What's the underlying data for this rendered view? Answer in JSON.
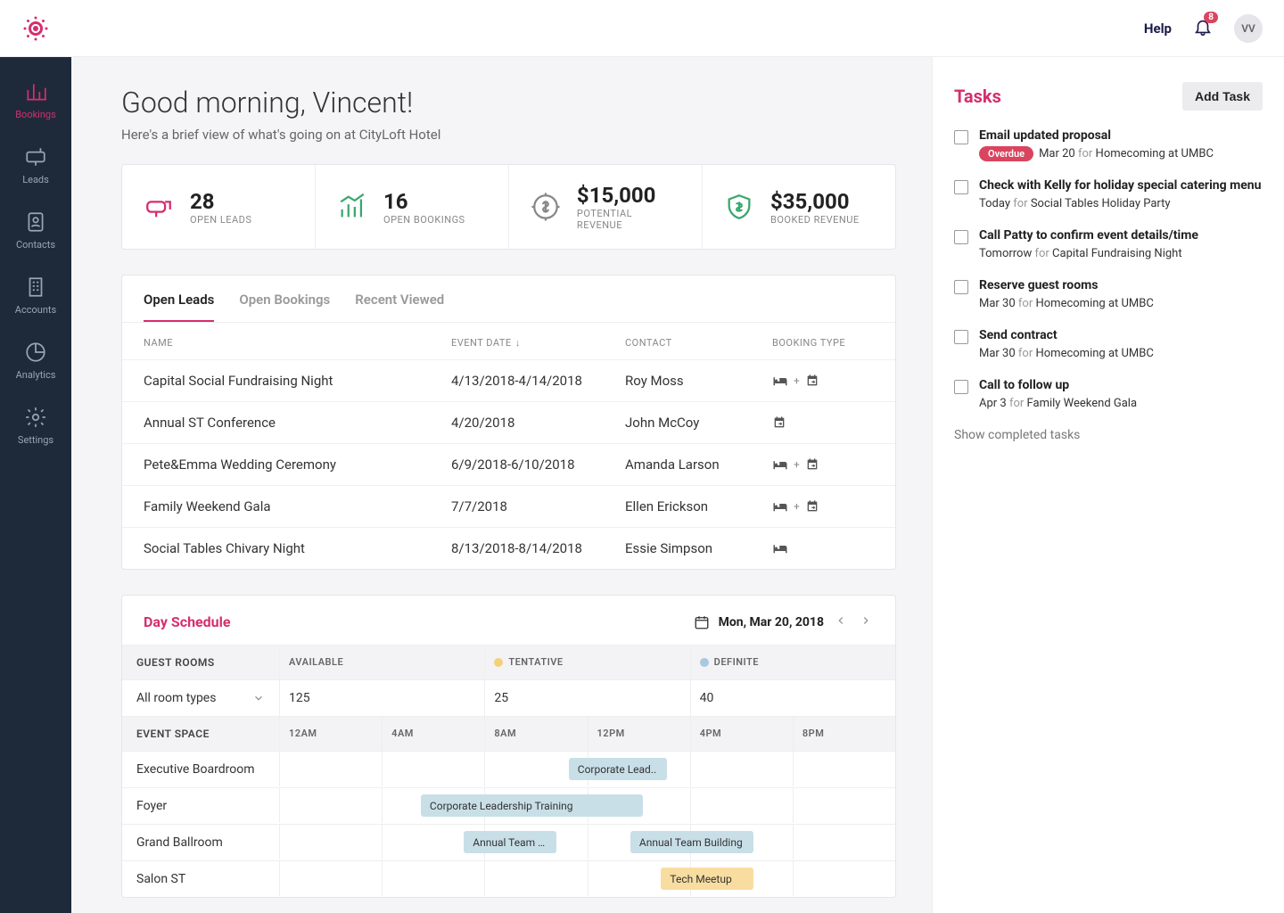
{
  "topbar": {
    "help": "Help",
    "notif_count": "8",
    "avatar": "VV"
  },
  "sidenav": [
    {
      "id": "bookings",
      "label": "Bookings"
    },
    {
      "id": "leads",
      "label": "Leads"
    },
    {
      "id": "contacts",
      "label": "Contacts"
    },
    {
      "id": "accounts",
      "label": "Accounts"
    },
    {
      "id": "analytics",
      "label": "Analytics"
    },
    {
      "id": "settings",
      "label": "Settings"
    }
  ],
  "header": {
    "greeting": "Good morning, Vincent!",
    "subtitle": "Here's a brief view of what's going on at CityLoft Hotel"
  },
  "stats": [
    {
      "value": "28",
      "label": "OPEN LEADS"
    },
    {
      "value": "16",
      "label": "OPEN BOOKINGS"
    },
    {
      "value": "$15,000",
      "label": "POTENTIAL REVENUE"
    },
    {
      "value": "$35,000",
      "label": "BOOKED REVENUE"
    }
  ],
  "tabs": {
    "open_leads": "Open Leads",
    "open_bookings": "Open Bookings",
    "recent_viewed": "Recent Viewed"
  },
  "table": {
    "cols": {
      "name": "NAME",
      "date": "EVENT DATE",
      "contact": "CONTACT",
      "type": "BOOKING TYPE"
    },
    "rows": [
      {
        "name": "Capital Social Fundraising Night",
        "date": "4/13/2018-4/14/2018",
        "contact": "Roy Moss",
        "types": [
          "bed",
          "cal"
        ]
      },
      {
        "name": "Annual ST Conference",
        "date": "4/20/2018",
        "contact": "John McCoy",
        "types": [
          "cal"
        ]
      },
      {
        "name": "Pete&Emma Wedding Ceremony",
        "date": "6/9/2018-6/10/2018",
        "contact": "Amanda Larson",
        "types": [
          "bed",
          "cal"
        ]
      },
      {
        "name": "Family Weekend Gala",
        "date": "7/7/2018",
        "contact": "Ellen Erickson",
        "types": [
          "bed",
          "cal"
        ]
      },
      {
        "name": "Social Tables Chivary Night",
        "date": "8/13/2018-8/14/2018",
        "contact": "Essie Simpson",
        "types": [
          "bed"
        ]
      }
    ]
  },
  "schedule": {
    "title": "Day Schedule",
    "date": "Mon, Mar 20, 2018",
    "guest_rooms_label": "GUEST ROOMS",
    "available_label": "AVAILABLE",
    "tentative_label": "TENTATIVE",
    "definite_label": "DEFINITE",
    "room_type_label": "All room types",
    "available_val": "125",
    "tentative_val": "25",
    "definite_val": "40",
    "event_space_label": "EVENT SPACE",
    "hours": [
      "12AM",
      "4AM",
      "8AM",
      "12PM",
      "4PM",
      "8PM"
    ],
    "rooms": [
      {
        "name": "Executive Boardroom",
        "events": [
          {
            "label": "Corporate Lead..",
            "start": 47,
            "width": 16,
            "cls": "ev-def"
          }
        ]
      },
      {
        "name": "Foyer",
        "events": [
          {
            "label": "Corporate Leadership Training",
            "start": 23,
            "width": 36,
            "cls": "ev-def"
          }
        ]
      },
      {
        "name": "Grand Ballroom",
        "events": [
          {
            "label": "Annual Team …",
            "start": 30,
            "width": 15,
            "cls": "ev-def"
          },
          {
            "label": "Annual Team Building",
            "start": 57,
            "width": 20,
            "cls": "ev-def"
          }
        ]
      },
      {
        "name": "Salon ST",
        "events": [
          {
            "label": "Tech Meetup",
            "start": 62,
            "width": 15,
            "cls": "ev-tent"
          }
        ]
      }
    ]
  },
  "tasks": {
    "title": "Tasks",
    "add": "Add Task",
    "show_completed": "Show completed tasks",
    "overdue_label": "Overdue",
    "items": [
      {
        "title": "Email updated proposal",
        "overdue": true,
        "date": "Mar 20",
        "event": "Homecoming at UMBC"
      },
      {
        "title": "Check with Kelly for holiday special catering menu",
        "date": "Today",
        "event": "Social Tables Holiday Party"
      },
      {
        "title": "Call Patty to confirm event details/time",
        "date": "Tomorrow",
        "event": "Capital Fundraising Night"
      },
      {
        "title": "Reserve guest rooms",
        "date": "Mar 30",
        "event": "Homecoming at UMBC"
      },
      {
        "title": "Send contract",
        "date": "Mar 30",
        "event": "Homecoming at UMBC"
      },
      {
        "title": "Call to follow up",
        "date": "Apr 3",
        "event": "Family Weekend Gala"
      }
    ]
  }
}
